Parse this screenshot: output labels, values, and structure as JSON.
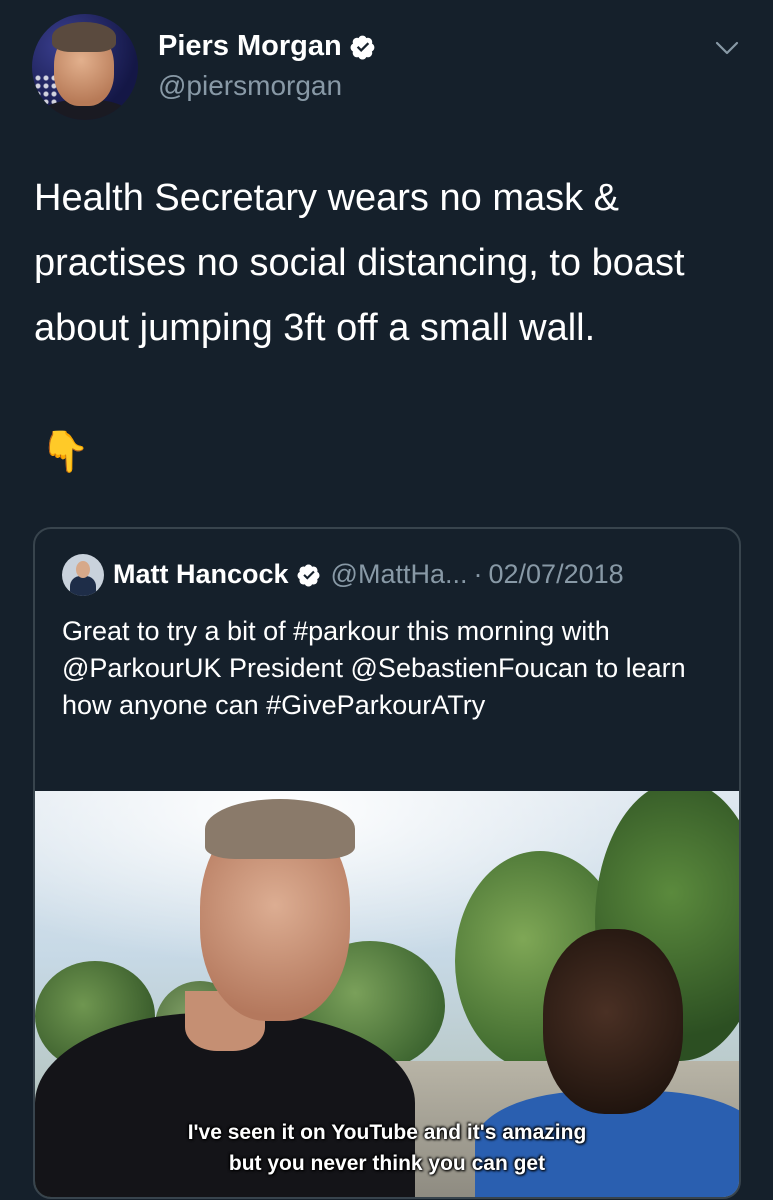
{
  "tweet": {
    "display_name": "Piers Morgan",
    "handle": "@piersmorgan",
    "text": "Health Secretary wears no mask & practises no social distancing, to boast about jumping 3ft off a small wall.",
    "emoji": "👇"
  },
  "quote": {
    "display_name": "Matt Hancock",
    "handle": "@MattHa...",
    "separator": "·",
    "date": "02/07/2018",
    "text": "Great to try a bit of #parkour this morning with @ParkourUK President @SebastienFoucan to learn how anyone can #GiveParkourATry",
    "media": {
      "caption_line1": "I've seen it on YouTube and it's amazing",
      "caption_line2": "but you never think you can get"
    }
  },
  "icons": {
    "verified": "verified-badge-icon",
    "menu": "chevron-down-icon"
  },
  "colors": {
    "background": "#15202b",
    "secondary_text": "#8899a6",
    "border": "#38444d"
  }
}
